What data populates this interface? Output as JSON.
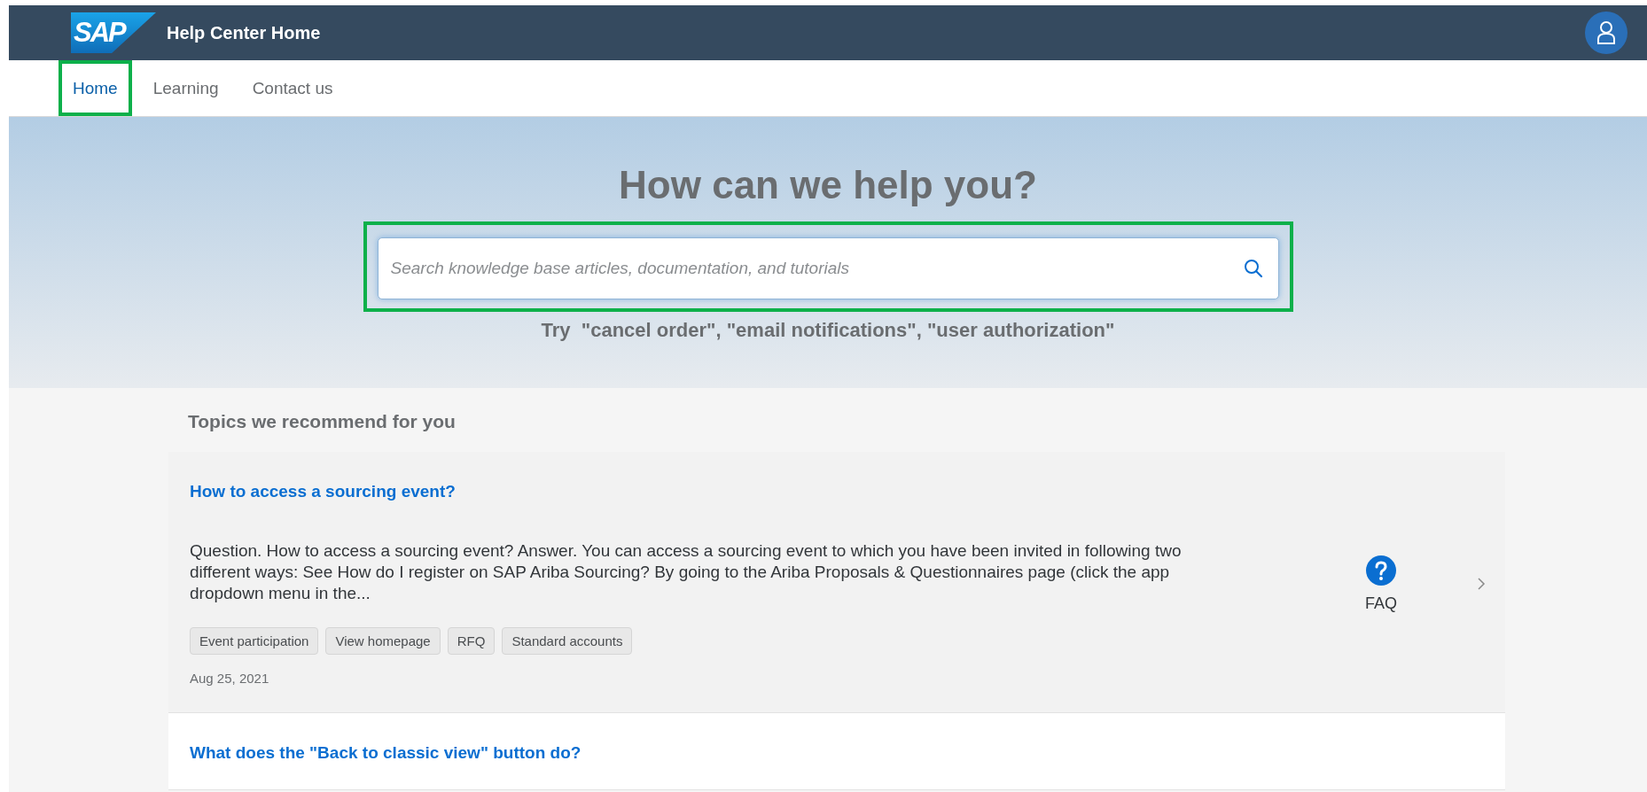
{
  "header": {
    "logo": "SAP",
    "title": "Help Center Home"
  },
  "tabs": [
    {
      "label": "Home",
      "selected": true,
      "highlighted": true
    },
    {
      "label": "Learning",
      "selected": false,
      "highlighted": false
    },
    {
      "label": "Contact us",
      "selected": false,
      "highlighted": false
    }
  ],
  "hero": {
    "heading": "How can we help you?",
    "search": {
      "placeholder": "Search knowledge base articles, documentation, and tutorials",
      "highlighted": true
    },
    "hint": "Try  \"cancel order\", \"email notifications\", \"user authorization\""
  },
  "section_title": "Topics we recommend for you",
  "articles": [
    {
      "title": "How to access a sourcing event?",
      "excerpt": "Question. How to access a sourcing event? Answer. You can access a sourcing event to which you have been invited in following two different ways: See How do I register on SAP Ariba Sourcing? By going to the Ariba Proposals & Questionnaires page (click the app dropdown menu in the...",
      "tags": [
        "Event participation",
        "View homepage",
        "RFQ",
        "Standard accounts"
      ],
      "date": "Aug 25, 2021",
      "type": "FAQ",
      "selected": true
    },
    {
      "title": "What does the \"Back to classic view\" button do?",
      "selected": false
    }
  ]
}
